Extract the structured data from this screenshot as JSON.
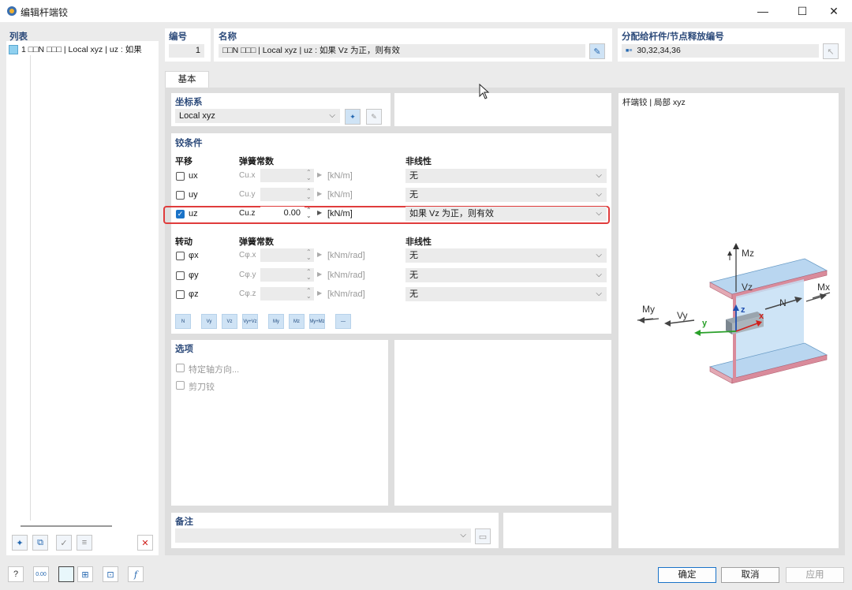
{
  "window": {
    "title": "编辑杆端铰",
    "minimize": "—",
    "maximize": "☐",
    "close": "✕"
  },
  "list": {
    "header": "列表",
    "items": [
      {
        "label": "1  □□N  □□□ | Local xyz | uz : 如果"
      }
    ]
  },
  "number": {
    "label": "编号",
    "value": "1"
  },
  "name": {
    "label": "名称",
    "value": "□□N  □□□ | Local xyz | uz : 如果 Vz 为正，则有效"
  },
  "assigned": {
    "label": "分配给杆件/节点释放编号",
    "value": "30,32,34,36"
  },
  "tabs": [
    {
      "label": "基本"
    }
  ],
  "coords": {
    "label": "坐标系",
    "value": "Local xyz"
  },
  "hinge": {
    "label": "铰条件",
    "translation": {
      "label": "平移",
      "spring_label": "弹簧常数",
      "nonlinear_label": "非线性",
      "rows": [
        {
          "name": "ux",
          "const": "Cu.x",
          "value": "",
          "unit": "[kN/m]",
          "nonlinear": "无",
          "checked": false
        },
        {
          "name": "uy",
          "const": "Cu.y",
          "value": "",
          "unit": "[kN/m]",
          "nonlinear": "无",
          "checked": false
        },
        {
          "name": "uz",
          "const": "Cu.z",
          "value": "0.00",
          "unit": "[kN/m]",
          "nonlinear": "如果 Vz 为正，则有效",
          "checked": true
        }
      ]
    },
    "rotation": {
      "label": "转动",
      "spring_label": "弹簧常数",
      "nonlinear_label": "非线性",
      "rows": [
        {
          "name": "φx",
          "const": "Cφ.x",
          "value": "",
          "unit": "[kNm/rad]",
          "nonlinear": "无",
          "checked": false
        },
        {
          "name": "φy",
          "const": "Cφ.y",
          "value": "",
          "unit": "[kNm/rad]",
          "nonlinear": "无",
          "checked": false
        },
        {
          "name": "φz",
          "const": "Cφ.z",
          "value": "",
          "unit": "[kNm/rad]",
          "nonlinear": "无",
          "checked": false
        }
      ]
    },
    "toolbar": [
      "N",
      "Vy",
      "Vz",
      "Vy+Vz",
      "My",
      "Mz",
      "My+Mz",
      "—"
    ]
  },
  "options": {
    "label": "选项",
    "items": [
      "特定轴方向...",
      "剪刀铰"
    ]
  },
  "notes": {
    "label": "备注",
    "value": ""
  },
  "preview": {
    "title": "杆端铰 | 局部 xyz",
    "labels": {
      "Mz": "Mz",
      "Vz": "Vz",
      "Mx": "Mx",
      "N": "N",
      "My": "My",
      "Vy": "Vy",
      "y": "y",
      "z": "z",
      "x": "x"
    }
  },
  "footer": {
    "ok": "确定",
    "cancel": "取消",
    "apply": "应用",
    "zero": "0.00"
  },
  "colors": {
    "accent": "#1a73c8",
    "highlight": "#e03c3c",
    "header": "#2c4a7a"
  }
}
